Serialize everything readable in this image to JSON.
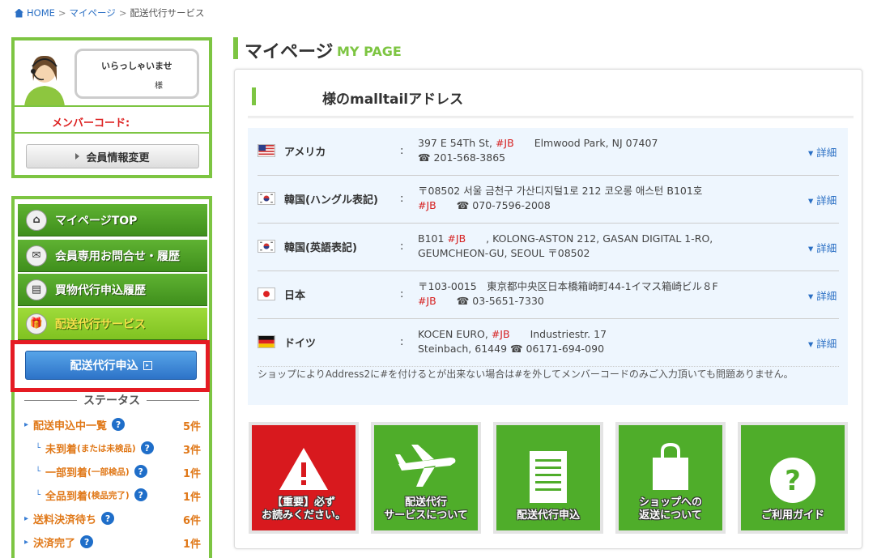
{
  "breadcrumb": {
    "home": "HOME",
    "sep1": ">",
    "mypage": "マイページ",
    "sep2": ">",
    "current": "配送代行サービス"
  },
  "welcome": {
    "greeting": "いらっしゃいませ",
    "suffix": "様",
    "member_code_label": "メンバーコード:",
    "edit_button": "会員情報変更"
  },
  "menu": {
    "items": [
      {
        "label": "マイページTOP",
        "icon": "home-icon"
      },
      {
        "label": "会員専用お問合せ・履歴",
        "icon": "mail-icon"
      },
      {
        "label": "買物代行申込履歴",
        "icon": "document-icon"
      },
      {
        "label": "配送代行サービス",
        "icon": "gift-icon"
      }
    ],
    "apply_button": "配送代行申込",
    "status_heading": "ステータス",
    "status": [
      {
        "label": "配送申込中一覧",
        "sub": "",
        "count": "5件",
        "level": 0
      },
      {
        "label": "未到着",
        "sub": "(または未検品)",
        "count": "3件",
        "level": 1
      },
      {
        "label": "一部到着",
        "sub": "(一部検品)",
        "count": "1件",
        "level": 1
      },
      {
        "label": "全品到着",
        "sub": "(検品完了)",
        "count": "1件",
        "level": 1
      },
      {
        "label": "送料決済待ち",
        "sub": "",
        "count": "6件",
        "level": 0
      },
      {
        "label": "決済完了",
        "sub": "",
        "count": "1件",
        "level": 0
      }
    ]
  },
  "page": {
    "title": "マイページ",
    "subtitle": "MY PAGE",
    "address_heading": "様のmalltailアドレス"
  },
  "addresses": [
    {
      "country": "アメリカ",
      "colon": ":",
      "line1a": "397 E 54Th St, ",
      "jb1": "#JB",
      "line1b": "　　Elmwood Park, NJ 07407",
      "line2": "☎ 201-568-3865",
      "detail": "▾ 詳細"
    },
    {
      "country": "韓国(ハングル表記)",
      "colon": ":",
      "line1a": "〒08502 서울 금천구 가산디지털1로 212 코오롱 애스턴 B101호",
      "jb1": "",
      "line1b": "",
      "line2pre": "#JB",
      "line2": "　　☎ 070-7596-2008",
      "detail": "▾ 詳細"
    },
    {
      "country": "韓国(英語表記)",
      "colon": ":",
      "line1a": "B101 ",
      "jb1": "#JB",
      "line1b": "　　, KOLONG-ASTON 212, GASAN DIGITAL 1-RO,",
      "line2": "GEUMCHEON-GU, SEOUL 〒08502",
      "detail": "▾ 詳細"
    },
    {
      "country": "日本",
      "colon": ":",
      "line1a": "〒103-0015　東京都中央区日本橋箱崎町44-1イマス箱崎ビル８F",
      "jb1": "",
      "line1b": "",
      "line2pre": "#JB",
      "line2": "　　☎ 03-5651-7330",
      "detail": "▾ 詳細"
    },
    {
      "country": "ドイツ",
      "colon": ":",
      "line1a": "KOCEN EURO, ",
      "jb1": "#JB",
      "line1b": "　　Industriestr. 17",
      "line2": "Steinbach, 61449 ☎ 06171-694-090",
      "detail": "▾ 詳細"
    }
  ],
  "note": "ショップによりAddress2に#を付けるとが出来ない場合は#を外してメンバーコードのみご入力頂いても問題ありません。",
  "tiles": [
    {
      "label1": "【重要】必ず",
      "label2": "お読みください。",
      "icon": "warning-icon"
    },
    {
      "label1": "配送代行",
      "label2": "サービスについて",
      "icon": "airplane-icon"
    },
    {
      "label1": "配送代行申込",
      "label2": "",
      "icon": "document-icon"
    },
    {
      "label1": "ショップへの",
      "label2": "返送について",
      "icon": "shopping-bag-icon"
    },
    {
      "label1": "ご利用ガイド",
      "label2": "",
      "icon": "question-icon"
    }
  ],
  "colors": {
    "accent": "#7dc542",
    "link": "#2a6fc4",
    "highlight": "#e51b23",
    "status": "#e07818"
  }
}
